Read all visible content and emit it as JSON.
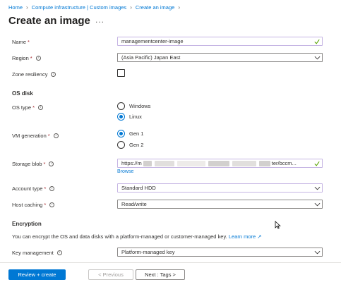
{
  "breadcrumb": {
    "items": [
      "Home",
      "Compute infrastructure | Custom images",
      "Create an image"
    ]
  },
  "page": {
    "title": "Create an image",
    "ellipsis": "..."
  },
  "form": {
    "name": {
      "label": "Name",
      "value": "managementcenter-image"
    },
    "region": {
      "label": "Region",
      "value": "(Asia Pacific) Japan East"
    },
    "zone_resiliency": {
      "label": "Zone resiliency"
    },
    "os_disk_heading": "OS disk",
    "os_type": {
      "label": "OS type",
      "options": [
        "Windows",
        "Linux"
      ],
      "selected": "Linux"
    },
    "vm_generation": {
      "label": "VM generation",
      "options": [
        "Gen 1",
        "Gen 2"
      ],
      "selected": "Gen 1"
    },
    "storage_blob": {
      "label": "Storage blob",
      "value_prefix": "https://m",
      "value_suffix": "ter/bccm...",
      "browse": "Browse"
    },
    "account_type": {
      "label": "Account type",
      "value": "Standard HDD"
    },
    "host_caching": {
      "label": "Host caching",
      "value": "Read/write"
    },
    "encryption_heading": "Encryption",
    "encryption_desc": "You can encrypt the OS and data disks with a platform-managed or customer-managed key.",
    "learn_more": "Learn more",
    "key_management": {
      "label": "Key management",
      "value": "Platform-managed key"
    }
  },
  "footer": {
    "review_create": "Review + create",
    "previous": "< Previous",
    "next": "Next : Tags >"
  },
  "colors": {
    "accent": "#0078d4",
    "required": "#a4262c",
    "valid_check": "#57a300"
  }
}
